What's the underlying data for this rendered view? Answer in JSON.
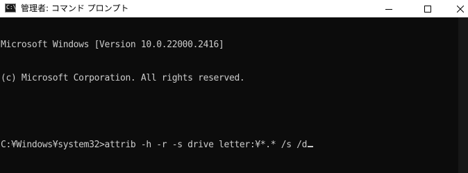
{
  "window": {
    "title": "管理者: コマンド プロンプト",
    "icon": "cmd-app-icon",
    "icon_glyph": "C:\\",
    "controls": {
      "minimize": "minimize-icon",
      "maximize": "maximize-icon",
      "close": "close-icon"
    }
  },
  "console": {
    "lines": [
      "Microsoft Windows [Version 10.0.22000.2416]",
      "(c) Microsoft Corporation. All rights reserved.",
      "",
      "C:¥Windows¥system32>attrib -h -r -s drive letter:¥*.* /s /d"
    ],
    "text_color": "#cccccc",
    "background": "#0c0c0c"
  }
}
